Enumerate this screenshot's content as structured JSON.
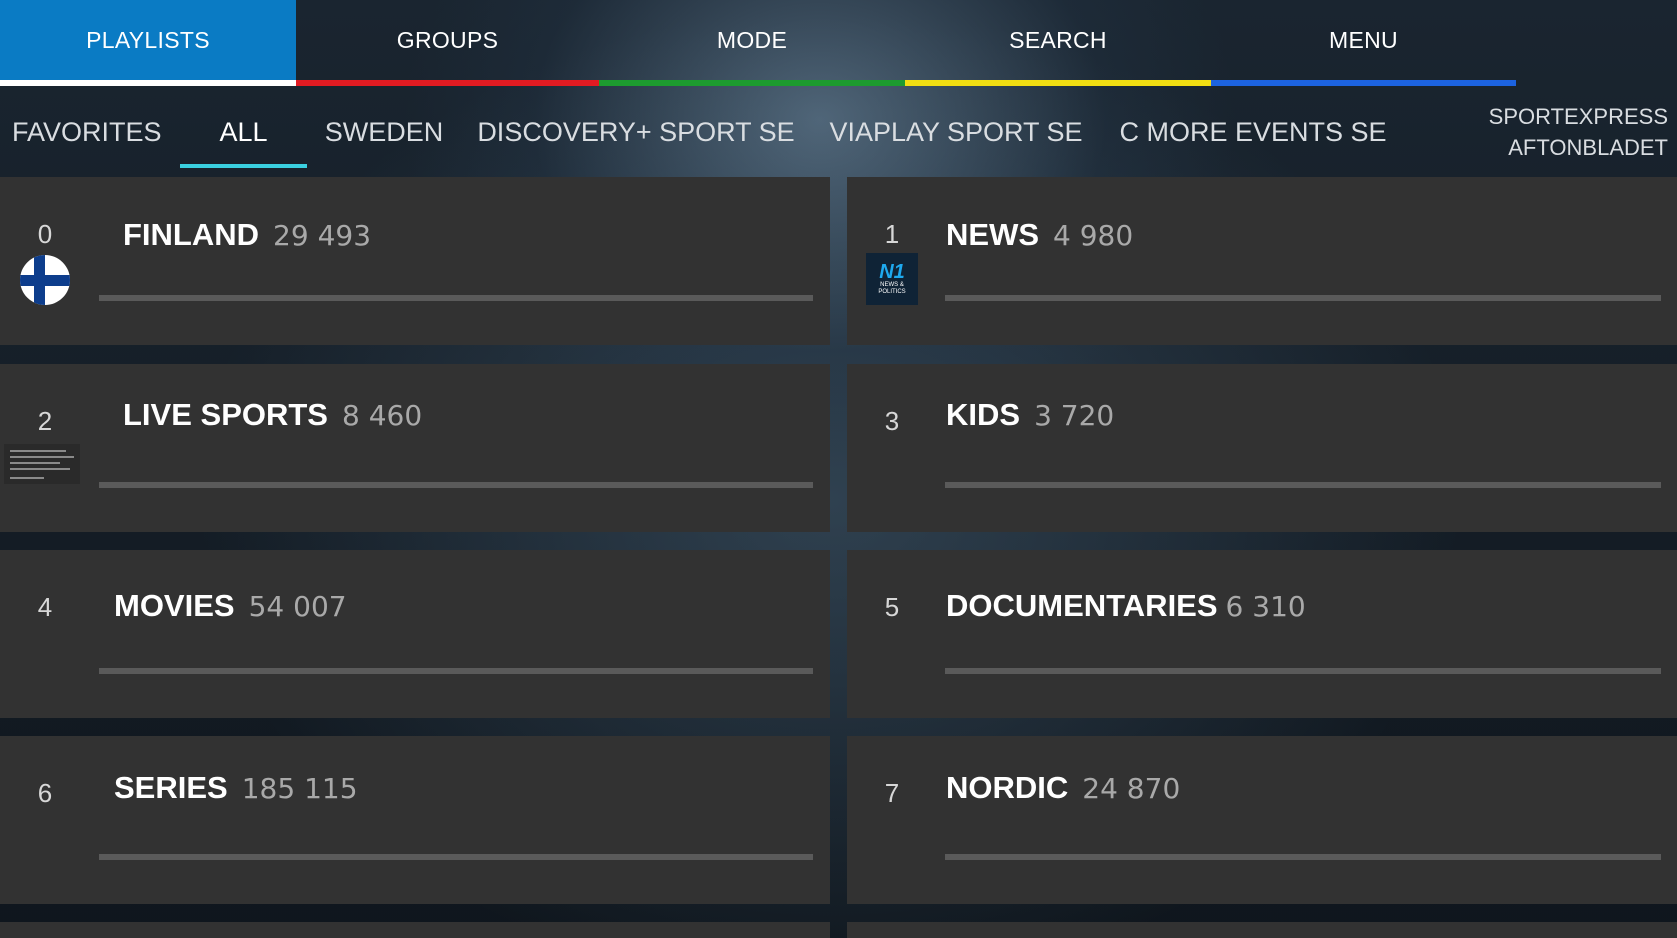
{
  "top_nav": [
    {
      "label": "PLAYLISTS",
      "active": true,
      "color": "#0a7bc4"
    },
    {
      "label": "GROUPS",
      "active": false,
      "color": "#e11b22"
    },
    {
      "label": "MODE",
      "active": false,
      "color": "#1d9b2f"
    },
    {
      "label": "SEARCH",
      "active": false,
      "color": "#f1de12"
    },
    {
      "label": "MENU",
      "active": false,
      "color": "#1c63e0"
    }
  ],
  "sub_tabs": [
    {
      "label": "FAVORITES",
      "active": false
    },
    {
      "label": "ALL",
      "active": true
    },
    {
      "label": "SWEDEN",
      "active": false
    },
    {
      "label": "DISCOVERY+ SPORT SE",
      "active": false
    },
    {
      "label": "VIAPLAY SPORT SE",
      "active": false
    },
    {
      "label": "C MORE EVENTS SE",
      "active": false
    },
    {
      "label_line1": "SPORTEXPRESS",
      "label_line2": "AFTONBLADET",
      "active": false
    }
  ],
  "groups": [
    {
      "index": "0",
      "name": "FINLAND",
      "count": "29 493",
      "logo": "finland-flag-icon"
    },
    {
      "index": "1",
      "name": "NEWS",
      "count": "4 980",
      "logo": "n1-news-logo",
      "logo_big": "N1",
      "logo_small": "NEWS & POLITICS"
    },
    {
      "index": "2",
      "name": "LIVE SPORTS",
      "count": "8 460",
      "logo": "sports-thumbnail"
    },
    {
      "index": "3",
      "name": "KIDS",
      "count": "3 720"
    },
    {
      "index": "4",
      "name": "MOVIES",
      "count": "54 007"
    },
    {
      "index": "5",
      "name": "DOCUMENTARIES",
      "count": "6 310"
    },
    {
      "index": "6",
      "name": "SERIES",
      "count": "185 115"
    },
    {
      "index": "7",
      "name": "NORDIC",
      "count": "24 870"
    }
  ],
  "colors": {
    "accent": "#0a7bc4",
    "active_tab_underline": "#3ad0e0",
    "card_bg": "#323232"
  }
}
